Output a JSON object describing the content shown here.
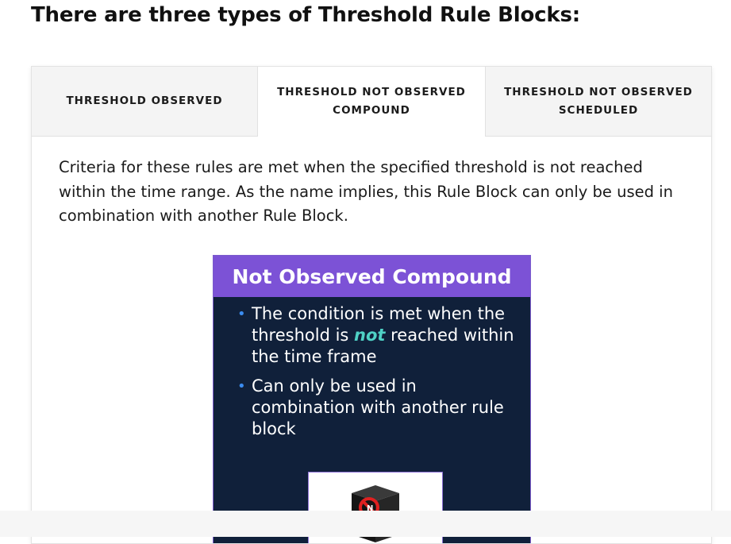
{
  "heading": "There are three types of Threshold Rule Blocks:",
  "tabs": [
    {
      "line1": "THRESHOLD OBSERVED",
      "line2": ""
    },
    {
      "line1": "THRESHOLD NOT OBSERVED",
      "line2": "COMPOUND"
    },
    {
      "line1": "THRESHOLD NOT OBSERVED",
      "line2": "SCHEDULED"
    }
  ],
  "active_tab_index": 1,
  "description": "Criteria for these rules are met when the specified threshold is not reached within the time range. As the name implies, this Rule Block can only be used in combination with another Rule Block.",
  "slide": {
    "title": "Not Observed Compound",
    "bullet1": {
      "pre": "The condition is met when the threshold is ",
      "emphasis": "not",
      "post": " reached within the time frame"
    },
    "bullet2": "Can only be used in combination with another rule block"
  },
  "colors": {
    "slide_title_bg": "#7c52d6",
    "slide_bg": "#10203a",
    "emphasis": "#4fd1c5",
    "bullet": "#3b8cf0"
  },
  "icons": [
    "server-no-icon"
  ]
}
